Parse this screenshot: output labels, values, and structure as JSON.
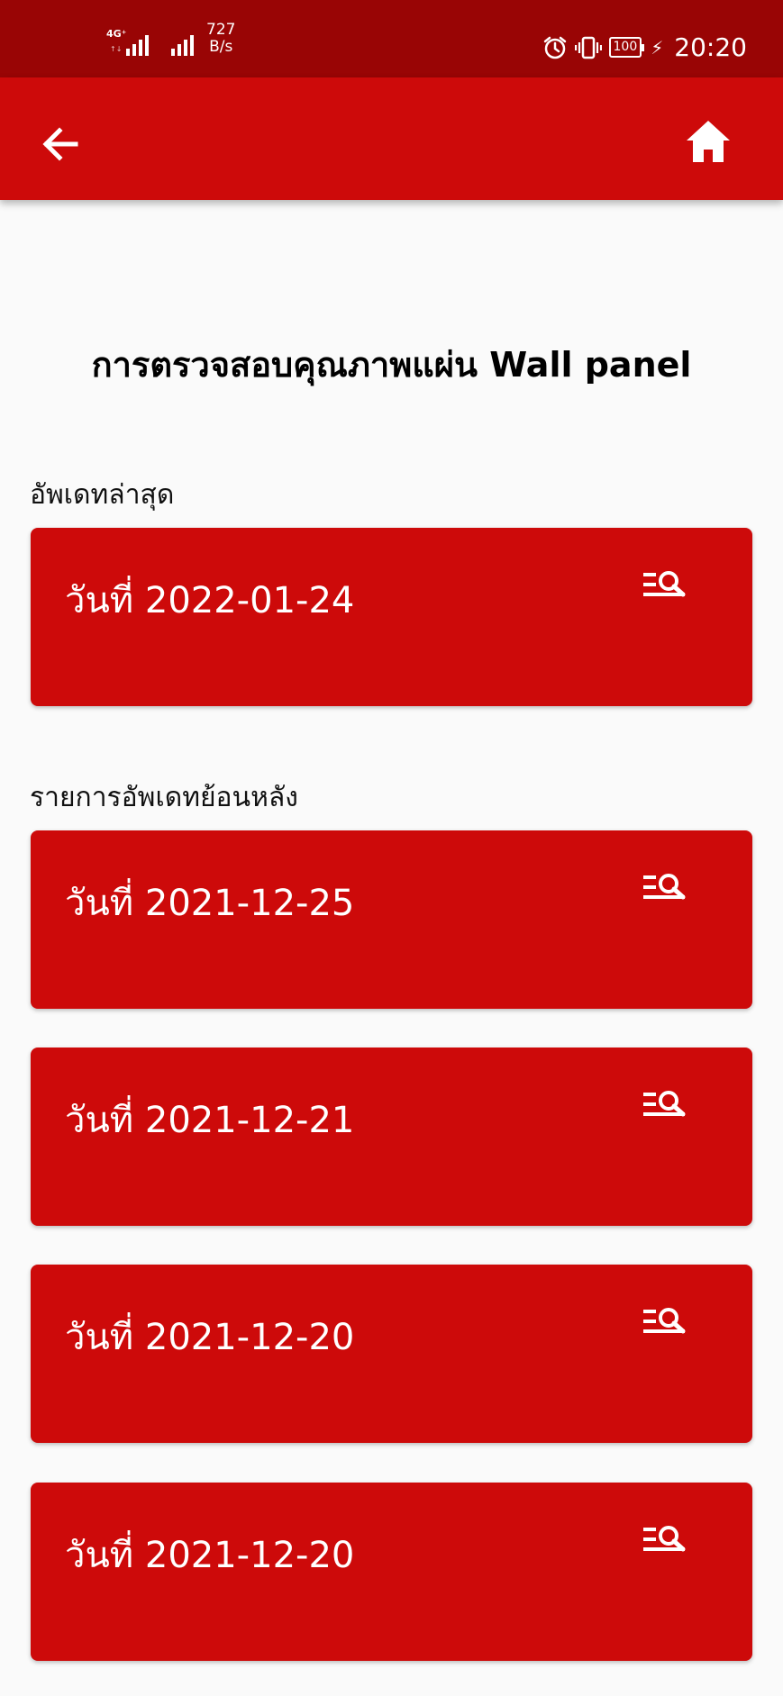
{
  "status_bar": {
    "network_type": "4G⁺",
    "network_sub": "↑↓",
    "speed_value": "727",
    "speed_unit": "B/s",
    "battery": "100",
    "time": "20:20",
    "icons": [
      "alarm-icon",
      "vibrate-icon",
      "battery-icon",
      "charging-icon"
    ]
  },
  "app_bar": {
    "back_icon": "arrow-back-icon",
    "home_icon": "home-icon"
  },
  "title": "การตรวจสอบคุณภาพแผ่น Wall panel",
  "latest": {
    "label": "อัพเดทล่าสุด",
    "items": [
      {
        "text": "วันที่ 2022-01-24"
      }
    ]
  },
  "history": {
    "label": "รายการอัพเดทย้อนหลัง",
    "items": [
      {
        "text": "วันที่ 2021-12-25"
      },
      {
        "text": "วันที่ 2021-12-21"
      },
      {
        "text": "วันที่ 2021-12-20"
      },
      {
        "text": "วันที่ 2021-12-20"
      }
    ]
  },
  "card_icon": "list-search-icon",
  "colors": {
    "status_bar": "#990505",
    "primary": "#cd0a0a",
    "background": "#fafafa",
    "on_primary": "#ffffff"
  }
}
